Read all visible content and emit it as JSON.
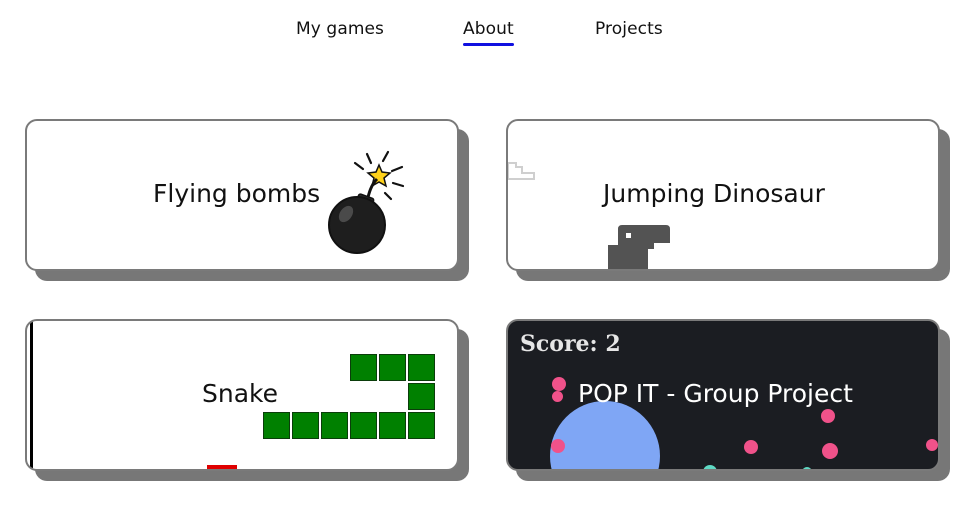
{
  "nav": {
    "items": [
      {
        "label": "My games",
        "active": false
      },
      {
        "label": "About",
        "active": true
      },
      {
        "label": "Projects",
        "active": false
      }
    ],
    "accent_color": "#1010e0"
  },
  "cards": [
    {
      "title": "Flying bombs",
      "icon": "bomb-icon"
    },
    {
      "title": "Jumping Dinosaur",
      "icon": "dinosaur-icon"
    },
    {
      "title": "Snake",
      "icon": "snake-icon"
    },
    {
      "title": "POP IT - Group Project",
      "score_text": "Score: 2",
      "icon": "bubbles-icon"
    }
  ]
}
